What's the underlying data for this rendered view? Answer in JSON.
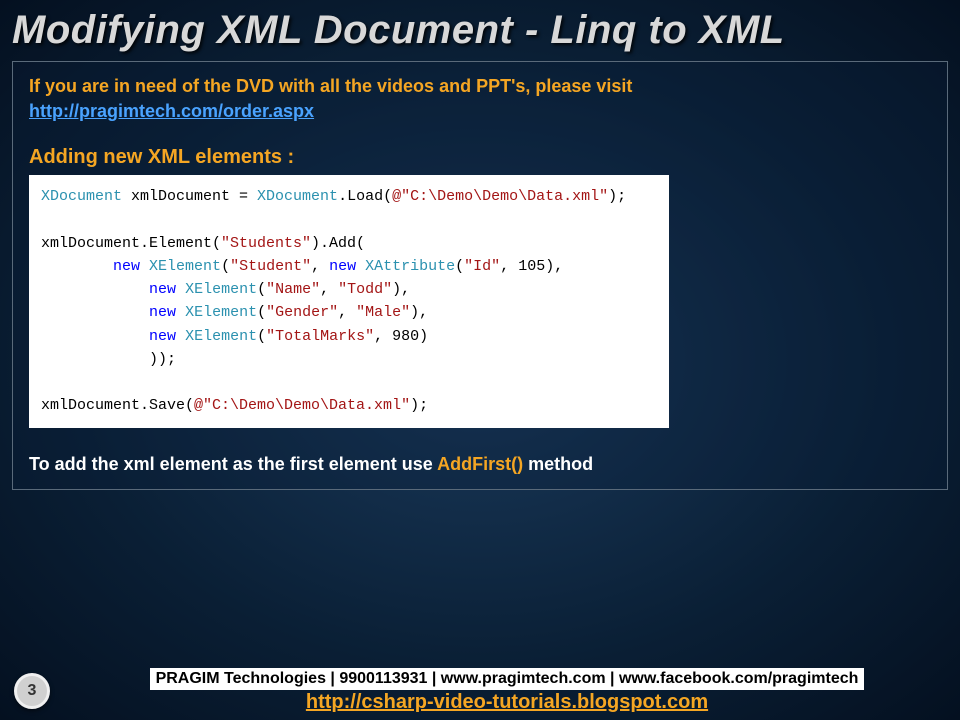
{
  "title": "Modifying XML Document - Linq to XML",
  "intro": "If you are in need of the DVD with all the videos and PPT's, please visit",
  "order_url": "http://pragimtech.com/order.aspx",
  "section": "Adding new XML elements :",
  "code": {
    "l1_a": "XDocument",
    "l1_b": " xmlDocument = ",
    "l1_c": "XDocument",
    "l1_d": ".Load(",
    "l1_e": "@\"C:\\Demo\\Demo\\Data.xml\"",
    "l1_f": ");",
    "l3_a": "xmlDocument.Element(",
    "l3_b": "\"Students\"",
    "l3_c": ").Add(",
    "l4_a": "        ",
    "l4_b": "new",
    "l4_c": " ",
    "l4_d": "XElement",
    "l4_e": "(",
    "l4_f": "\"Student\"",
    "l4_g": ", ",
    "l4_h": "new",
    "l4_i": " ",
    "l4_j": "XAttribute",
    "l4_k": "(",
    "l4_l": "\"Id\"",
    "l4_m": ", 105),",
    "l5_a": "            ",
    "l5_b": "new",
    "l5_c": " ",
    "l5_d": "XElement",
    "l5_e": "(",
    "l5_f": "\"Name\"",
    "l5_g": ", ",
    "l5_h": "\"Todd\"",
    "l5_i": "),",
    "l6_a": "            ",
    "l6_b": "new",
    "l6_c": " ",
    "l6_d": "XElement",
    "l6_e": "(",
    "l6_f": "\"Gender\"",
    "l6_g": ", ",
    "l6_h": "\"Male\"",
    "l6_i": "),",
    "l7_a": "            ",
    "l7_b": "new",
    "l7_c": " ",
    "l7_d": "XElement",
    "l7_e": "(",
    "l7_f": "\"TotalMarks\"",
    "l7_g": ", 980)",
    "l8": "            ));",
    "l10_a": "xmlDocument.Save(",
    "l10_b": "@\"C:\\Demo\\Demo\\Data.xml\"",
    "l10_c": ");"
  },
  "footnote_pre": "To add the xml element as the first element use ",
  "footnote_hl": "AddFirst()",
  "footnote_post": " method",
  "page_number": "3",
  "company": "PRAGIM Technologies | 9900113931 | www.pragimtech.com | www.facebook.com/pragimtech",
  "blog": "http://csharp-video-tutorials.blogspot.com"
}
